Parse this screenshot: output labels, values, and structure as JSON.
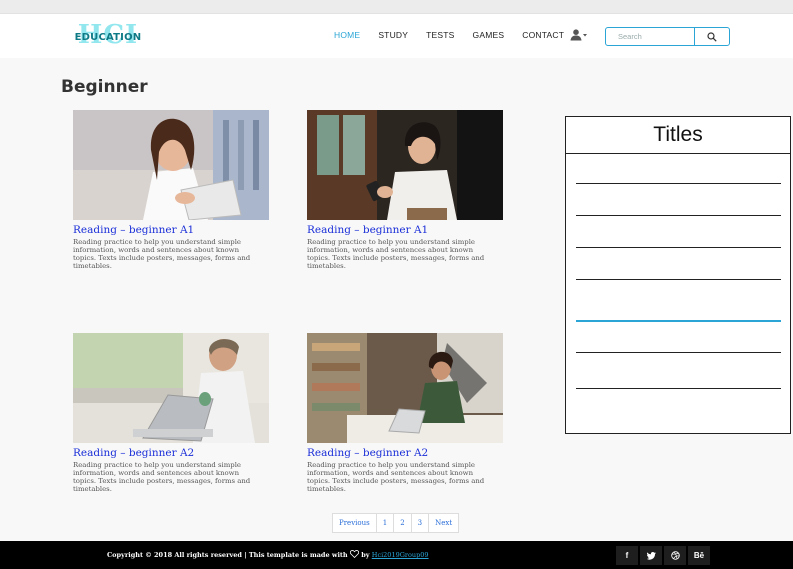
{
  "header": {
    "logo_text": "HCI",
    "logo_subtext": "EDUCATION",
    "nav": [
      {
        "label": "HOME",
        "active": true
      },
      {
        "label": "STUDY",
        "active": false
      },
      {
        "label": "TESTS",
        "active": false
      },
      {
        "label": "GAMES",
        "active": false
      },
      {
        "label": "CONTACT",
        "active": false
      }
    ],
    "user_icon": "user-dropdown-icon",
    "search_placeholder": "Search",
    "search_icon": "search-icon"
  },
  "main": {
    "page_title": "Beginner",
    "cards": [
      {
        "title": "Reading – beginner A1",
        "description": "Reading practice to help you understand simple information, words and sentences about known topics. Texts include posters, messages, forms and timetables."
      },
      {
        "title": "Reading – beginner A1",
        "description": "Reading practice to help you understand simple information, words and sentences about known topics. Texts include posters, messages, forms and timetables."
      },
      {
        "title": "Reading – beginner A2",
        "description": "Reading practice to help you understand simple information, words and sentences about known topics. Texts include posters, messages, forms and timetables."
      },
      {
        "title": "Reading – beginner A2",
        "description": "Reading practice to help you understand simple information, words and sentences about known topics. Texts include posters, messages, forms and timetables."
      }
    ],
    "pagination": [
      "Previous",
      "1",
      "2",
      "3",
      "Next"
    ]
  },
  "sidebar": {
    "heading": "Titles",
    "selected_index": 4
  },
  "footer": {
    "copyright": "Copyright © 2018 All rights reserved | This template is made with",
    "by": "by",
    "author": "Hci2019Group09",
    "social": [
      "f",
      "t",
      "d",
      "Bē"
    ]
  },
  "colors": {
    "accent": "#2aa5d6",
    "link": "#1b2fd8",
    "footer_bg": "#000000"
  }
}
